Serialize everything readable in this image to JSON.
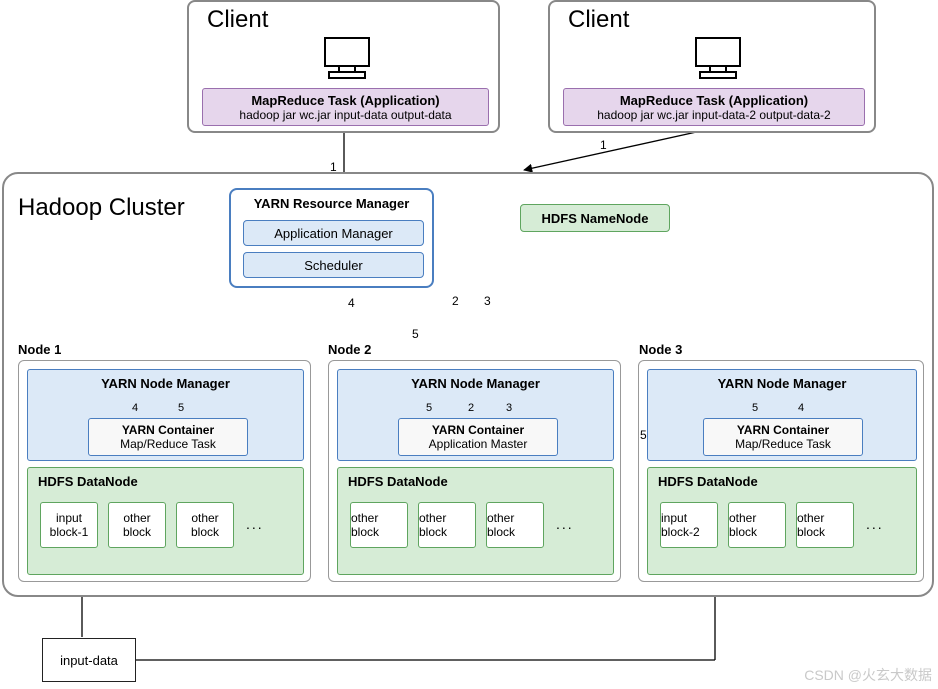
{
  "client1": {
    "title": "Client",
    "task_title": "MapReduce Task (Application)",
    "task_cmd": "hadoop jar wc.jar input-data output-data"
  },
  "client2": {
    "title": "Client",
    "task_title": "MapReduce Task (Application)",
    "task_cmd": "hadoop jar wc.jar input-data-2 output-data-2"
  },
  "cluster": {
    "title": "Hadoop Cluster",
    "rm": {
      "title": "YARN Resource Manager",
      "app_mgr": "Application Manager",
      "scheduler": "Scheduler"
    },
    "namenode": "HDFS NameNode",
    "nodes": [
      {
        "label": "Node 1",
        "nm": "YARN Node Manager",
        "container_title": "YARN Container",
        "container_role": "Map/Reduce Task",
        "nm_left_num": "4",
        "nm_right_num": "5",
        "datanode": "HDFS DataNode",
        "blocks": [
          "input block-1",
          "other block",
          "other block"
        ],
        "ellipsis": "..."
      },
      {
        "label": "Node 2",
        "nm": "YARN Node Manager",
        "container_title": "YARN Container",
        "container_role": "Application Master",
        "nm_left_num": "5",
        "nm_mid_num": "2",
        "nm_right_num": "3",
        "datanode": "HDFS DataNode",
        "blocks": [
          "other block",
          "other block",
          "other block"
        ],
        "ellipsis": "..."
      },
      {
        "label": "Node 3",
        "nm": "YARN Node Manager",
        "container_title": "YARN Container",
        "container_role": "Map/Reduce Task",
        "nm_left_num": "5",
        "nm_right_num": "4",
        "datanode": "HDFS DataNode",
        "blocks": [
          "input block-2",
          "other block",
          "other block"
        ],
        "ellipsis": "..."
      }
    ]
  },
  "edges": {
    "e1a": "1",
    "e1b": "1",
    "e2": "2",
    "e3": "3",
    "e4": "4",
    "e5a": "5",
    "e5b": "5"
  },
  "input_data": "input-data",
  "watermark": "CSDN @火玄大数据"
}
